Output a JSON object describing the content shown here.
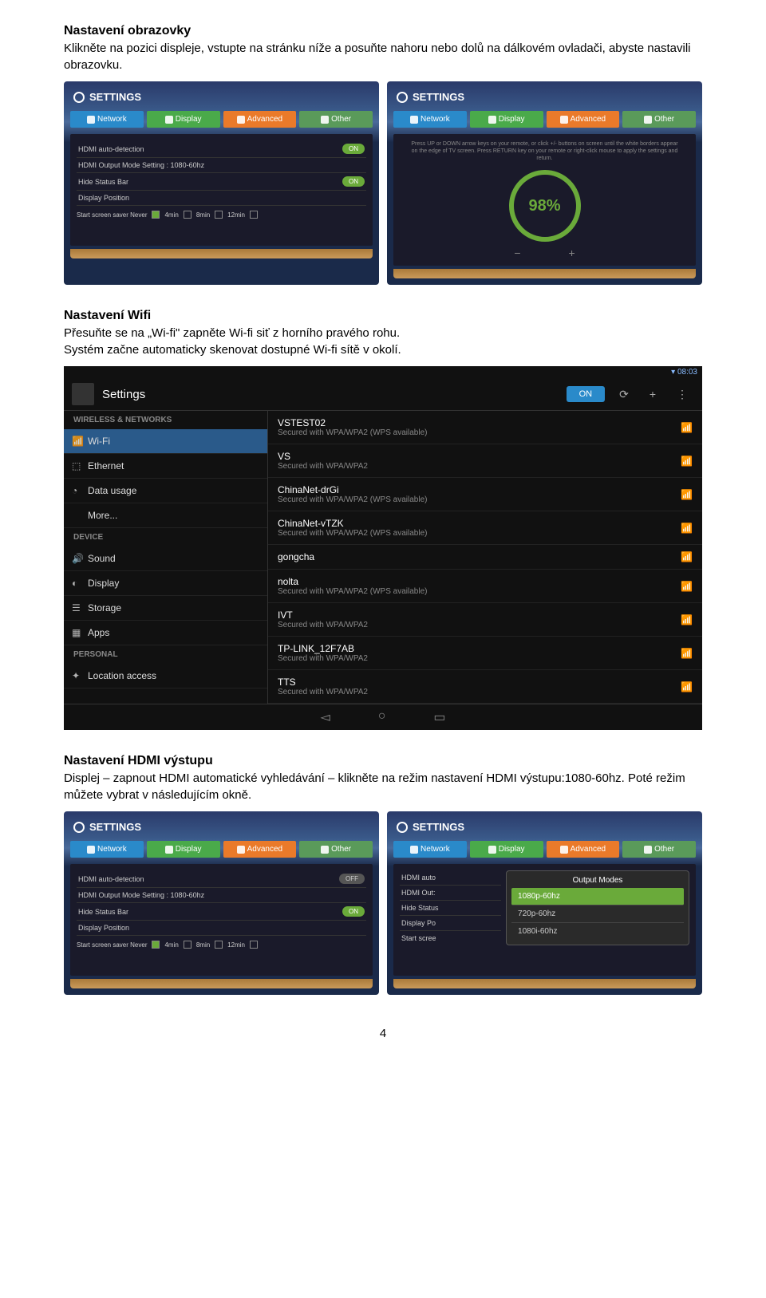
{
  "sections": {
    "screen": {
      "heading": "Nastavení obrazovky",
      "text": "Klikněte na pozici displeje, vstupte na stránku níže a posuňte nahoru nebo dolů na dálkovém ovladači, abyste nastavili obrazovku."
    },
    "wifi": {
      "heading": "Nastavení Wifi",
      "text1": "Přesuňte se na „Wi-fi\" zapněte Wi-fi siť z horního pravého rohu.",
      "text2": "Systém začne automaticky skenovat dostupné Wi-fi sítě v okolí."
    },
    "hdmi": {
      "heading": "Nastavení HDMI výstupu",
      "text": "Displej – zapnout HDMI automatické vyhledávání – klikněte na režim nastavení HDMI výstupu:1080-60hz. Poté režim můžete vybrat v následujícím okně."
    }
  },
  "panel": {
    "title": "SETTINGS",
    "tabs": {
      "network": "Network",
      "display": "Display",
      "advanced": "Advanced",
      "other": "Other"
    },
    "rows": {
      "hdmi_auto": "HDMI auto-detection",
      "hdmi_mode": "HDMI Output Mode Setting : 1080-60hz",
      "hide_status": "Hide Status Bar",
      "display_pos": "Display Position",
      "saver_label": "Start screen saver   Never",
      "saver_4": "4min",
      "saver_8": "8min",
      "saver_12": "12min",
      "on": "ON",
      "off": "OFF"
    },
    "ring_hint": "Press UP or DOWN arrow keys on your remote, or click +/- buttons on screen until the white borders appear on the edge of TV screen. Press RETURN key on your remote or right-click mouse to apply the settings and return.",
    "ring_value": "98%"
  },
  "android": {
    "time": "08:03",
    "title": "Settings",
    "toggle": "ON",
    "left_headers": {
      "wireless": "WIRELESS & NETWORKS",
      "device": "DEVICE",
      "personal": "PERSONAL"
    },
    "left_items": {
      "wifi": "Wi-Fi",
      "ethernet": "Ethernet",
      "data": "Data usage",
      "more": "More...",
      "sound": "Sound",
      "display": "Display",
      "storage": "Storage",
      "apps": "Apps",
      "location": "Location access"
    },
    "networks": [
      {
        "name": "VSTEST02",
        "sub": "Secured with WPA/WPA2 (WPS available)"
      },
      {
        "name": "VS",
        "sub": "Secured with WPA/WPA2"
      },
      {
        "name": "ChinaNet-drGi",
        "sub": "Secured with WPA/WPA2 (WPS available)"
      },
      {
        "name": "ChinaNet-vTZK",
        "sub": "Secured with WPA/WPA2 (WPS available)"
      },
      {
        "name": "gongcha",
        "sub": ""
      },
      {
        "name": "nolta",
        "sub": "Secured with WPA/WPA2 (WPS available)"
      },
      {
        "name": "IVT",
        "sub": "Secured with WPA/WPA2"
      },
      {
        "name": "TP-LINK_12F7AB",
        "sub": "Secured with WPA/WPA2"
      },
      {
        "name": "TTS",
        "sub": "Secured with WPA/WPA2"
      }
    ]
  },
  "popup": {
    "title": "Output Modes",
    "opt1": "1080p-60hz",
    "opt2": "720p-60hz",
    "opt3": "1080i-60hz",
    "partial_rows": {
      "hdmi_auto": "HDMI auto",
      "hdmi_out": "HDMI Out:",
      "hide": "Hide Status",
      "display": "Display Po",
      "start": "Start scree"
    }
  },
  "page_num": "4"
}
